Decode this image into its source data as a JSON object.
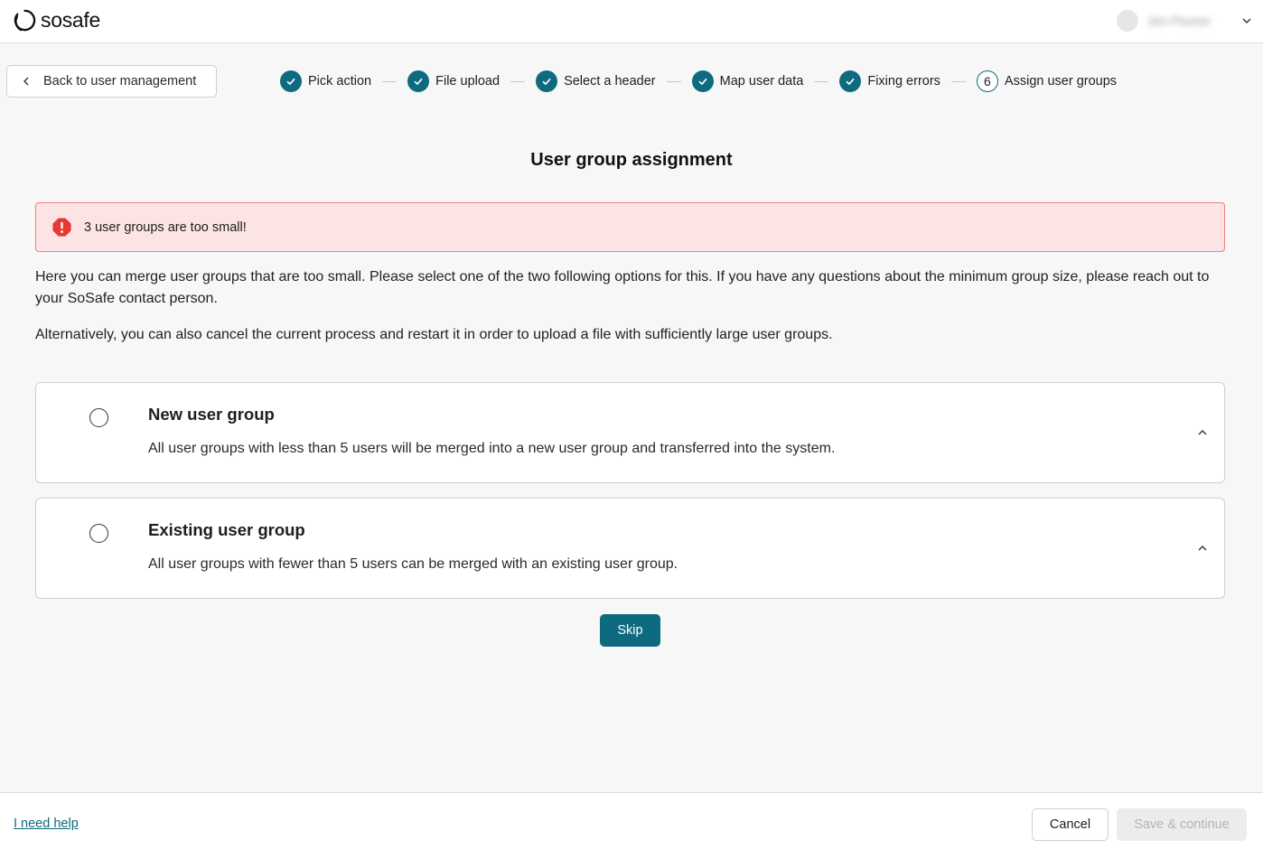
{
  "header": {
    "logo_text": "sosafe",
    "user_name": "Jim Plumer"
  },
  "nav": {
    "back_label": "Back to user management"
  },
  "stepper": {
    "steps": [
      {
        "label": "Pick action",
        "status": "done"
      },
      {
        "label": "File upload",
        "status": "done"
      },
      {
        "label": "Select a header",
        "status": "done"
      },
      {
        "label": "Map user data",
        "status": "done"
      },
      {
        "label": "Fixing errors",
        "status": "done"
      },
      {
        "label": "Assign user groups",
        "status": "current",
        "number": "6"
      }
    ]
  },
  "main": {
    "title": "User group assignment",
    "alert": "3 user groups are too small!",
    "paragraph1": "Here you can merge user groups that are too small. Please select one of the two following options for this. If you have any questions about the minimum group size, please reach out to your SoSafe contact person.",
    "paragraph2": "Alternatively, you can also cancel the current process and restart it in order to upload a file with sufficiently large user groups.",
    "options": [
      {
        "title": "New user group",
        "description": "All user groups with less than 5 users will be merged into a new user group and transferred into the system.",
        "selected": false
      },
      {
        "title": "Existing user group",
        "description": "All user groups with fewer than 5 users can be merged with an existing user group.",
        "selected": false
      }
    ],
    "skip_label": "Skip"
  },
  "footer": {
    "help_label": "I need help",
    "cancel_label": "Cancel",
    "save_label": "Save & continue"
  },
  "colors": {
    "accent": "#0e6a7e",
    "alert_bg": "#fde4e4",
    "alert_border": "#ef8080",
    "alert_icon": "#e53935"
  }
}
